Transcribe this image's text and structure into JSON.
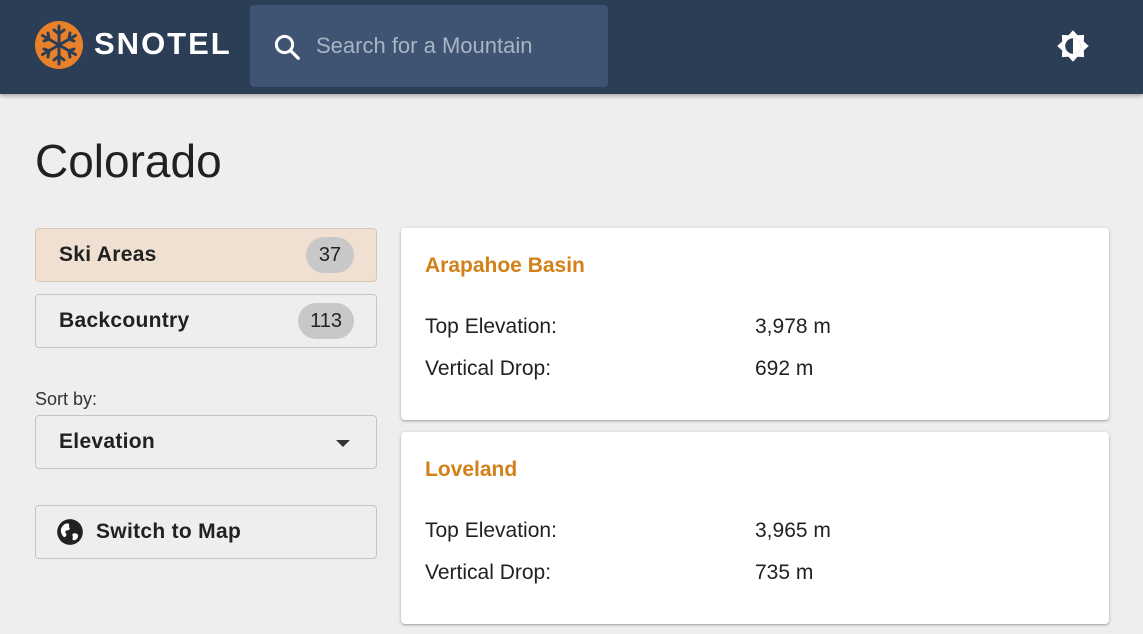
{
  "header": {
    "brand": "SNOTEL",
    "search_placeholder": "Search for a Mountain",
    "logo_icon": "snowflake-logo-icon",
    "theme_icon": "brightness-toggle-icon",
    "colors": {
      "bar": "#2c3e56",
      "search": "#3e5472",
      "logo": "#e9812a"
    }
  },
  "page": {
    "title": "Colorado"
  },
  "sidebar": {
    "filters": [
      {
        "label": "Ski Areas",
        "count": "37",
        "active": true
      },
      {
        "label": "Backcountry",
        "count": "113",
        "active": false
      }
    ],
    "sort_label": "Sort by:",
    "sort_value": "Elevation",
    "map_button_label": "Switch to Map",
    "map_icon": "globe-icon"
  },
  "results": [
    {
      "name": "Arapahoe Basin",
      "stats": [
        {
          "label": "Top Elevation:",
          "value": "3,978 m"
        },
        {
          "label": "Vertical Drop:",
          "value": "692 m"
        }
      ]
    },
    {
      "name": "Loveland",
      "stats": [
        {
          "label": "Top Elevation:",
          "value": "3,965 m"
        },
        {
          "label": "Vertical Drop:",
          "value": "735 m"
        }
      ]
    }
  ],
  "colors": {
    "accent": "#d48019",
    "active_filter": "#efe0d2"
  }
}
